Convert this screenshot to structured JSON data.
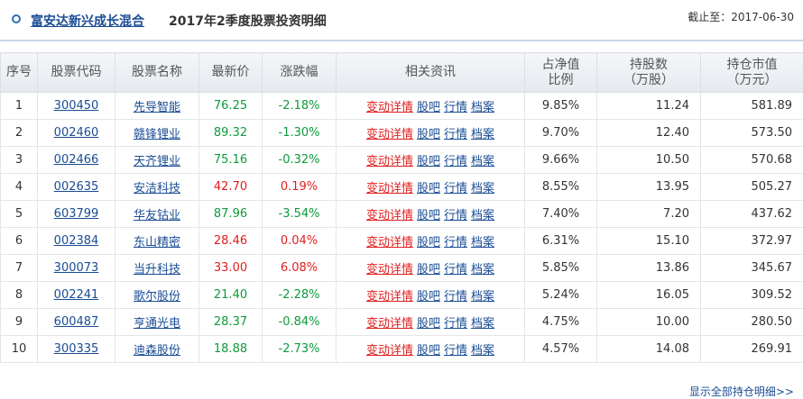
{
  "header": {
    "fund_name": "富安达新兴成长混合",
    "title": "2017年2季度股票投资明细",
    "as_of": "截止至：2017-06-30"
  },
  "columns": {
    "idx": "序号",
    "code": "股票代码",
    "name": "股票名称",
    "price": "最新价",
    "change": "涨跌幅",
    "info": "相关资讯",
    "ratio_1": "占净值",
    "ratio_2": "比例",
    "shares_1": "持股数",
    "shares_2": "（万股）",
    "value_1": "持仓市值",
    "value_2": "（万元）"
  },
  "info_links": {
    "detail": "变动详情",
    "forum": "股吧",
    "quote": "行情",
    "archive": "档案"
  },
  "rows": [
    {
      "idx": "1",
      "code": "300450",
      "name": "先导智能",
      "price": "76.25",
      "change": "-2.18%",
      "dir": "down",
      "ratio": "9.85%",
      "shares": "11.24",
      "value": "581.89"
    },
    {
      "idx": "2",
      "code": "002460",
      "name": "赣锋锂业",
      "price": "89.32",
      "change": "-1.30%",
      "dir": "down",
      "ratio": "9.70%",
      "shares": "12.40",
      "value": "573.50"
    },
    {
      "idx": "3",
      "code": "002466",
      "name": "天齐锂业",
      "price": "75.16",
      "change": "-0.32%",
      "dir": "down",
      "ratio": "9.66%",
      "shares": "10.50",
      "value": "570.68"
    },
    {
      "idx": "4",
      "code": "002635",
      "name": "安洁科技",
      "price": "42.70",
      "change": "0.19%",
      "dir": "up",
      "ratio": "8.55%",
      "shares": "13.95",
      "value": "505.27"
    },
    {
      "idx": "5",
      "code": "603799",
      "name": "华友钴业",
      "price": "87.96",
      "change": "-3.54%",
      "dir": "down",
      "ratio": "7.40%",
      "shares": "7.20",
      "value": "437.62"
    },
    {
      "idx": "6",
      "code": "002384",
      "name": "东山精密",
      "price": "28.46",
      "change": "0.04%",
      "dir": "up",
      "ratio": "6.31%",
      "shares": "15.10",
      "value": "372.97"
    },
    {
      "idx": "7",
      "code": "300073",
      "name": "当升科技",
      "price": "33.00",
      "change": "6.08%",
      "dir": "up",
      "ratio": "5.85%",
      "shares": "13.86",
      "value": "345.67"
    },
    {
      "idx": "8",
      "code": "002241",
      "name": "歌尔股份",
      "price": "21.40",
      "change": "-2.28%",
      "dir": "down",
      "ratio": "5.24%",
      "shares": "16.05",
      "value": "309.52"
    },
    {
      "idx": "9",
      "code": "600487",
      "name": "亨通光电",
      "price": "28.37",
      "change": "-0.84%",
      "dir": "down",
      "ratio": "4.75%",
      "shares": "10.00",
      "value": "280.50"
    },
    {
      "idx": "10",
      "code": "300335",
      "name": "迪森股份",
      "price": "18.88",
      "change": "-2.73%",
      "dir": "down",
      "ratio": "4.57%",
      "shares": "14.08",
      "value": "269.91"
    }
  ],
  "footer": {
    "show_all": "显示全部持仓明细>>"
  },
  "colors": {
    "up": "#e01e1e",
    "down": "#0e9a3c",
    "link": "#1a4c94"
  }
}
